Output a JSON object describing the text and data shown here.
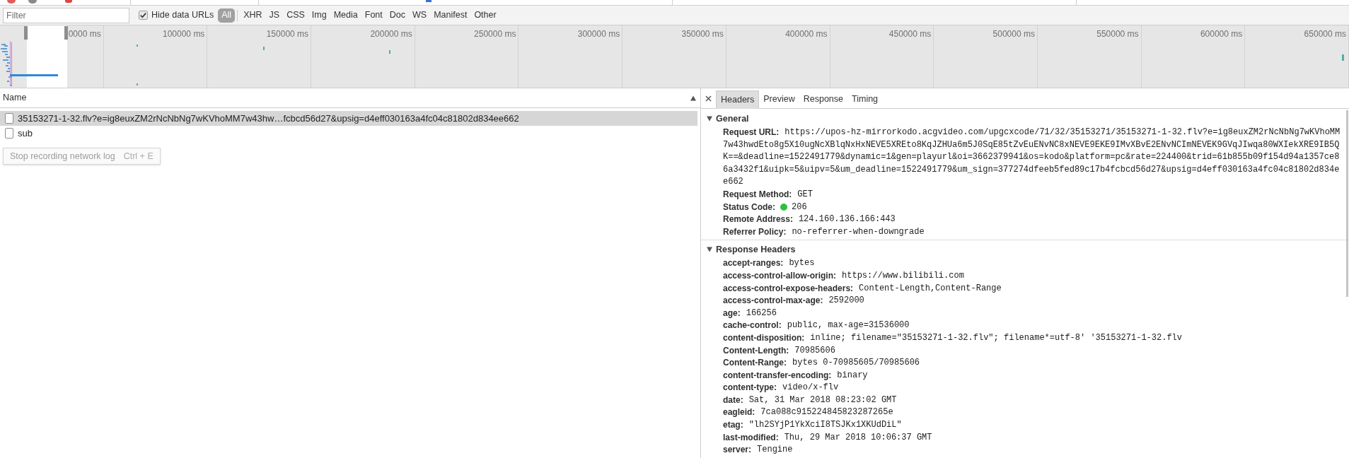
{
  "toolbar": {
    "filter": {
      "placeholder": "Filter"
    },
    "tooltip": {
      "text": "Stop recording network log",
      "shortcut": "Ctrl + E"
    },
    "hide_data_urls": {
      "label": "Hide data URLs",
      "checked": true
    },
    "type_filters": [
      {
        "label": "All",
        "selected": true
      },
      {
        "label": "XHR",
        "selected": false
      },
      {
        "label": "JS",
        "selected": false
      },
      {
        "label": "CSS",
        "selected": false
      },
      {
        "label": "Img",
        "selected": false
      },
      {
        "label": "Media",
        "selected": false
      },
      {
        "label": "Font",
        "selected": false
      },
      {
        "label": "Doc",
        "selected": false
      },
      {
        "label": "WS",
        "selected": false
      },
      {
        "label": "Manifest",
        "selected": false
      },
      {
        "label": "Other",
        "selected": false
      }
    ]
  },
  "overview": {
    "ticks": [
      "0000 ms",
      "100000 ms",
      "150000 ms",
      "200000 ms",
      "250000 ms",
      "300000 ms",
      "350000 ms",
      "400000 ms",
      "450000 ms",
      "500000 ms",
      "550000 ms",
      "600000 ms",
      "650000 ms"
    ]
  },
  "requests": {
    "column": "Name",
    "sorted_ascending": true,
    "rows": [
      {
        "name": "35153271-1-32.flv?e=ig8euxZM2rNcNbNg7wKVhoMM7w43hw…fcbcd56d27&upsig=d4eff030163a4fc04c81802d834ee662",
        "selected": true
      },
      {
        "name": "sub",
        "selected": false
      }
    ]
  },
  "details": {
    "tabs": [
      {
        "label": "Headers",
        "selected": true
      },
      {
        "label": "Preview",
        "selected": false
      },
      {
        "label": "Response",
        "selected": false
      },
      {
        "label": "Timing",
        "selected": false
      }
    ],
    "sections": [
      {
        "title": "General",
        "expanded": true,
        "rows": [
          {
            "name": "Request URL:",
            "value": "https://upos-hz-mirrorkodo.acgvideo.com/upgcxcode/71/32/35153271/35153271-1-32.flv?e=ig8euxZM2rNcNbNg7wKVhoMM7w43hwdEto8g5X10ugNcXBlqNxHxNEVE5XREto8KqJZHUa6m5J0SqE85tZvEuENvNC8xNEVE9EKE9IMvXBvE2ENvNCImNEVEK9GVqJIwqa80WXIekXRE9IB5QK==&deadline=1522491779&dynamic=1&gen=playurl&oi=3662379941&os=kodo&platform=pc&rate=224400&trid=61b855b09f154d94a1357ce86a3432f1&uipk=5&uipv=5&um_deadline=1522491779&um_sign=377274dfeeb5fed89c17b4fcbcd56d27&upsig=d4eff030163a4fc04c81802d834ee662"
          },
          {
            "name": "Request Method:",
            "value": "GET"
          },
          {
            "name": "Status Code:",
            "value": "206",
            "color": "#2fbf3f"
          },
          {
            "name": "Remote Address:",
            "value": "124.160.136.166:443"
          },
          {
            "name": "Referrer Policy:",
            "value": "no-referrer-when-downgrade"
          }
        ]
      },
      {
        "title": "Response Headers",
        "expanded": true,
        "rows": [
          {
            "name": "accept-ranges:",
            "value": "bytes"
          },
          {
            "name": "access-control-allow-origin:",
            "value": "https://www.bilibili.com"
          },
          {
            "name": "access-control-expose-headers:",
            "value": "Content-Length,Content-Range"
          },
          {
            "name": "access-control-max-age:",
            "value": "2592000"
          },
          {
            "name": "age:",
            "value": "166256"
          },
          {
            "name": "cache-control:",
            "value": "public, max-age=31536000"
          },
          {
            "name": "content-disposition:",
            "value": "inline; filename=\"35153271-1-32.flv\"; filename*=utf-8' '35153271-1-32.flv"
          },
          {
            "name": "Content-Length:",
            "value": "70985606"
          },
          {
            "name": "Content-Range:",
            "value": "bytes 0-70985605/70985606"
          },
          {
            "name": "content-transfer-encoding:",
            "value": "binary"
          },
          {
            "name": "content-type:",
            "value": "video/x-flv"
          },
          {
            "name": "date:",
            "value": "Sat, 31 Mar 2018 08:23:02 GMT"
          },
          {
            "name": "eagleid:",
            "value": "7ca088c915224845823287265e"
          },
          {
            "name": "etag:",
            "value": "\"lh2SYjP1YkXciI8TSJKx1XKUdDiL\""
          },
          {
            "name": "last-modified:",
            "value": "Thu, 29 Mar 2018 10:06:37 GMT"
          },
          {
            "name": "server:",
            "value": "Tengine"
          }
        ]
      }
    ]
  }
}
